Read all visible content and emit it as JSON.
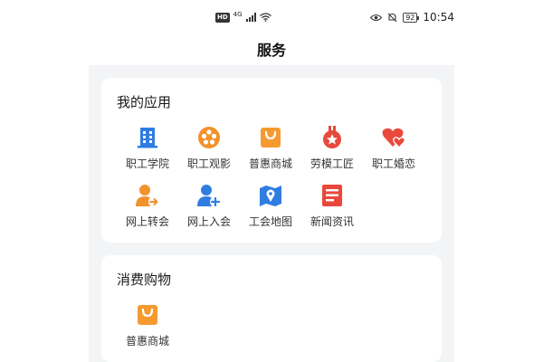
{
  "status_bar": {
    "hd": "HD",
    "network": "4G",
    "battery": "92",
    "time": "10:54"
  },
  "nav": {
    "title": "服务"
  },
  "my_apps": {
    "title": "我的应用",
    "items": [
      {
        "label": "职工学院",
        "icon": "building-icon",
        "color": "#2f7de1"
      },
      {
        "label": "职工观影",
        "icon": "film-reel-icon",
        "color": "#f2922c"
      },
      {
        "label": "普惠商城",
        "icon": "shopping-bag-icon",
        "color": "#f59a2f"
      },
      {
        "label": "劳模工匠",
        "icon": "medal-icon",
        "color": "#e8493b"
      },
      {
        "label": "职工婚恋",
        "icon": "hearts-icon",
        "color": "#e8493b"
      },
      {
        "label": "网上转会",
        "icon": "user-transfer-icon",
        "color": "#f2922c"
      },
      {
        "label": "网上入会",
        "icon": "user-add-icon",
        "color": "#2f7de1"
      },
      {
        "label": "工会地图",
        "icon": "map-icon",
        "color": "#2f7de1"
      },
      {
        "label": "新闻资讯",
        "icon": "news-icon",
        "color": "#e8493b"
      }
    ]
  },
  "consume": {
    "title": "消费购物",
    "items": [
      {
        "label": "普惠商城",
        "icon": "shopping-bag-icon",
        "color": "#f59a2f"
      }
    ]
  }
}
